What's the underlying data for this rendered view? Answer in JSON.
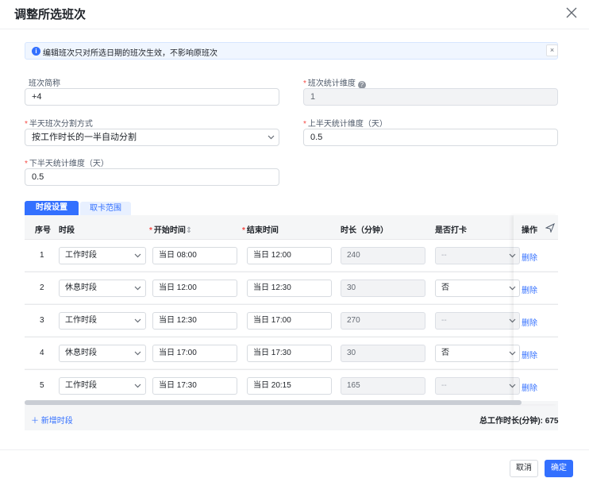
{
  "dialog": {
    "title": "调整所选班次",
    "notice": "编辑班次只对所选日期的班次生效，不影响原班次",
    "notice_close": "×"
  },
  "form": {
    "short_name": {
      "label": "班次简称",
      "value": "+4",
      "required": false
    },
    "stat_dimension": {
      "label": "班次统计维度",
      "value": "1",
      "required": true,
      "help": "?"
    },
    "half_day_split": {
      "label": "半天班次分割方式",
      "value": "按工作时长的一半自动分割",
      "required": true
    },
    "first_half_stat": {
      "label": "上半天统计维度（天）",
      "value": "0.5",
      "required": true
    },
    "second_half_stat": {
      "label": "下半天统计维度（天）",
      "value": "0.5",
      "required": true
    }
  },
  "tabs": [
    {
      "label": "时段设置",
      "active": true
    },
    {
      "label": "取卡范围",
      "active": false
    }
  ],
  "table": {
    "headers": {
      "index": "序号",
      "segment": "时段",
      "start": "开始时间",
      "sort_icon": "⇕",
      "end": "结束时间",
      "duration": "时长（分钟）",
      "clock": "是否打卡",
      "action": "操作"
    },
    "rows": [
      {
        "index": "1",
        "segment": "工作时段",
        "start": "当日 08:00",
        "end": "当日 12:00",
        "duration": "240",
        "clock": "--",
        "clock_disabled": true,
        "action": "删除"
      },
      {
        "index": "2",
        "segment": "休息时段",
        "start": "当日 12:00",
        "end": "当日 12:30",
        "duration": "30",
        "clock": "否",
        "clock_disabled": false,
        "action": "删除"
      },
      {
        "index": "3",
        "segment": "工作时段",
        "start": "当日 12:30",
        "end": "当日 17:00",
        "duration": "270",
        "clock": "--",
        "clock_disabled": true,
        "action": "删除"
      },
      {
        "index": "4",
        "segment": "休息时段",
        "start": "当日 17:00",
        "end": "当日 17:30",
        "duration": "30",
        "clock": "否",
        "clock_disabled": false,
        "action": "删除"
      },
      {
        "index": "5",
        "segment": "工作时段",
        "start": "当日 17:30",
        "end": "当日 20:15",
        "duration": "165",
        "clock": "--",
        "clock_disabled": true,
        "action": "删除"
      }
    ]
  },
  "add_segment": "新增时段",
  "total_label": "总工作时长(分钟): 675",
  "footer": {
    "cancel": "取消",
    "confirm": "确定"
  },
  "colors": {
    "primary": "#3370ff",
    "required": "#f54a45",
    "disabled_bg": "#f2f3f5"
  },
  "icons": {
    "close": "close-icon",
    "info": "info-icon",
    "help": "help-icon",
    "chevron": "chevron-down-icon",
    "pin": "pin-icon",
    "plus": "plus-icon"
  }
}
